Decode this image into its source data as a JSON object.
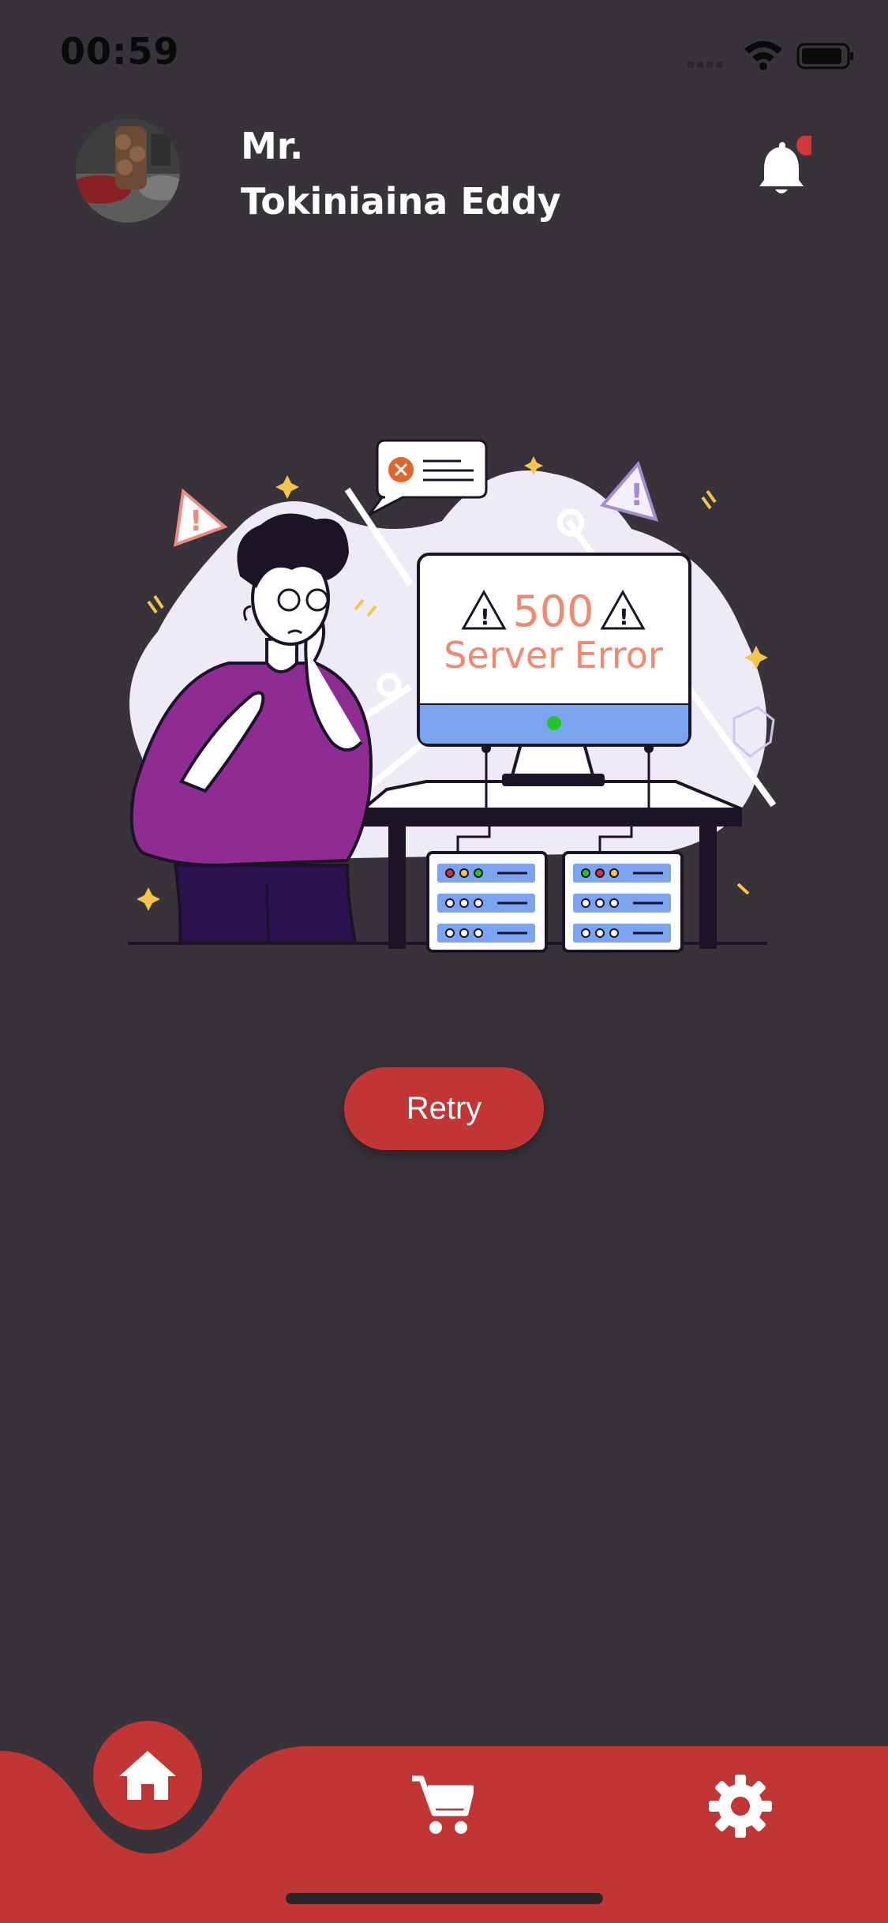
{
  "status_bar": {
    "time": "00:59"
  },
  "header": {
    "user_name_line1": "Mr.",
    "user_name_line2": "Tokiniaina Eddy",
    "notification_dot": true
  },
  "error": {
    "code": "500",
    "message": "Server Error"
  },
  "actions": {
    "retry_label": "Retry"
  },
  "bottom_nav": {
    "active": "home",
    "items": [
      {
        "icon": "home-icon"
      },
      {
        "icon": "cart-icon"
      },
      {
        "icon": "gear-icon"
      }
    ]
  },
  "colors": {
    "background": "#38333a",
    "accent": "#c13535",
    "error_text": "#f2896e"
  }
}
